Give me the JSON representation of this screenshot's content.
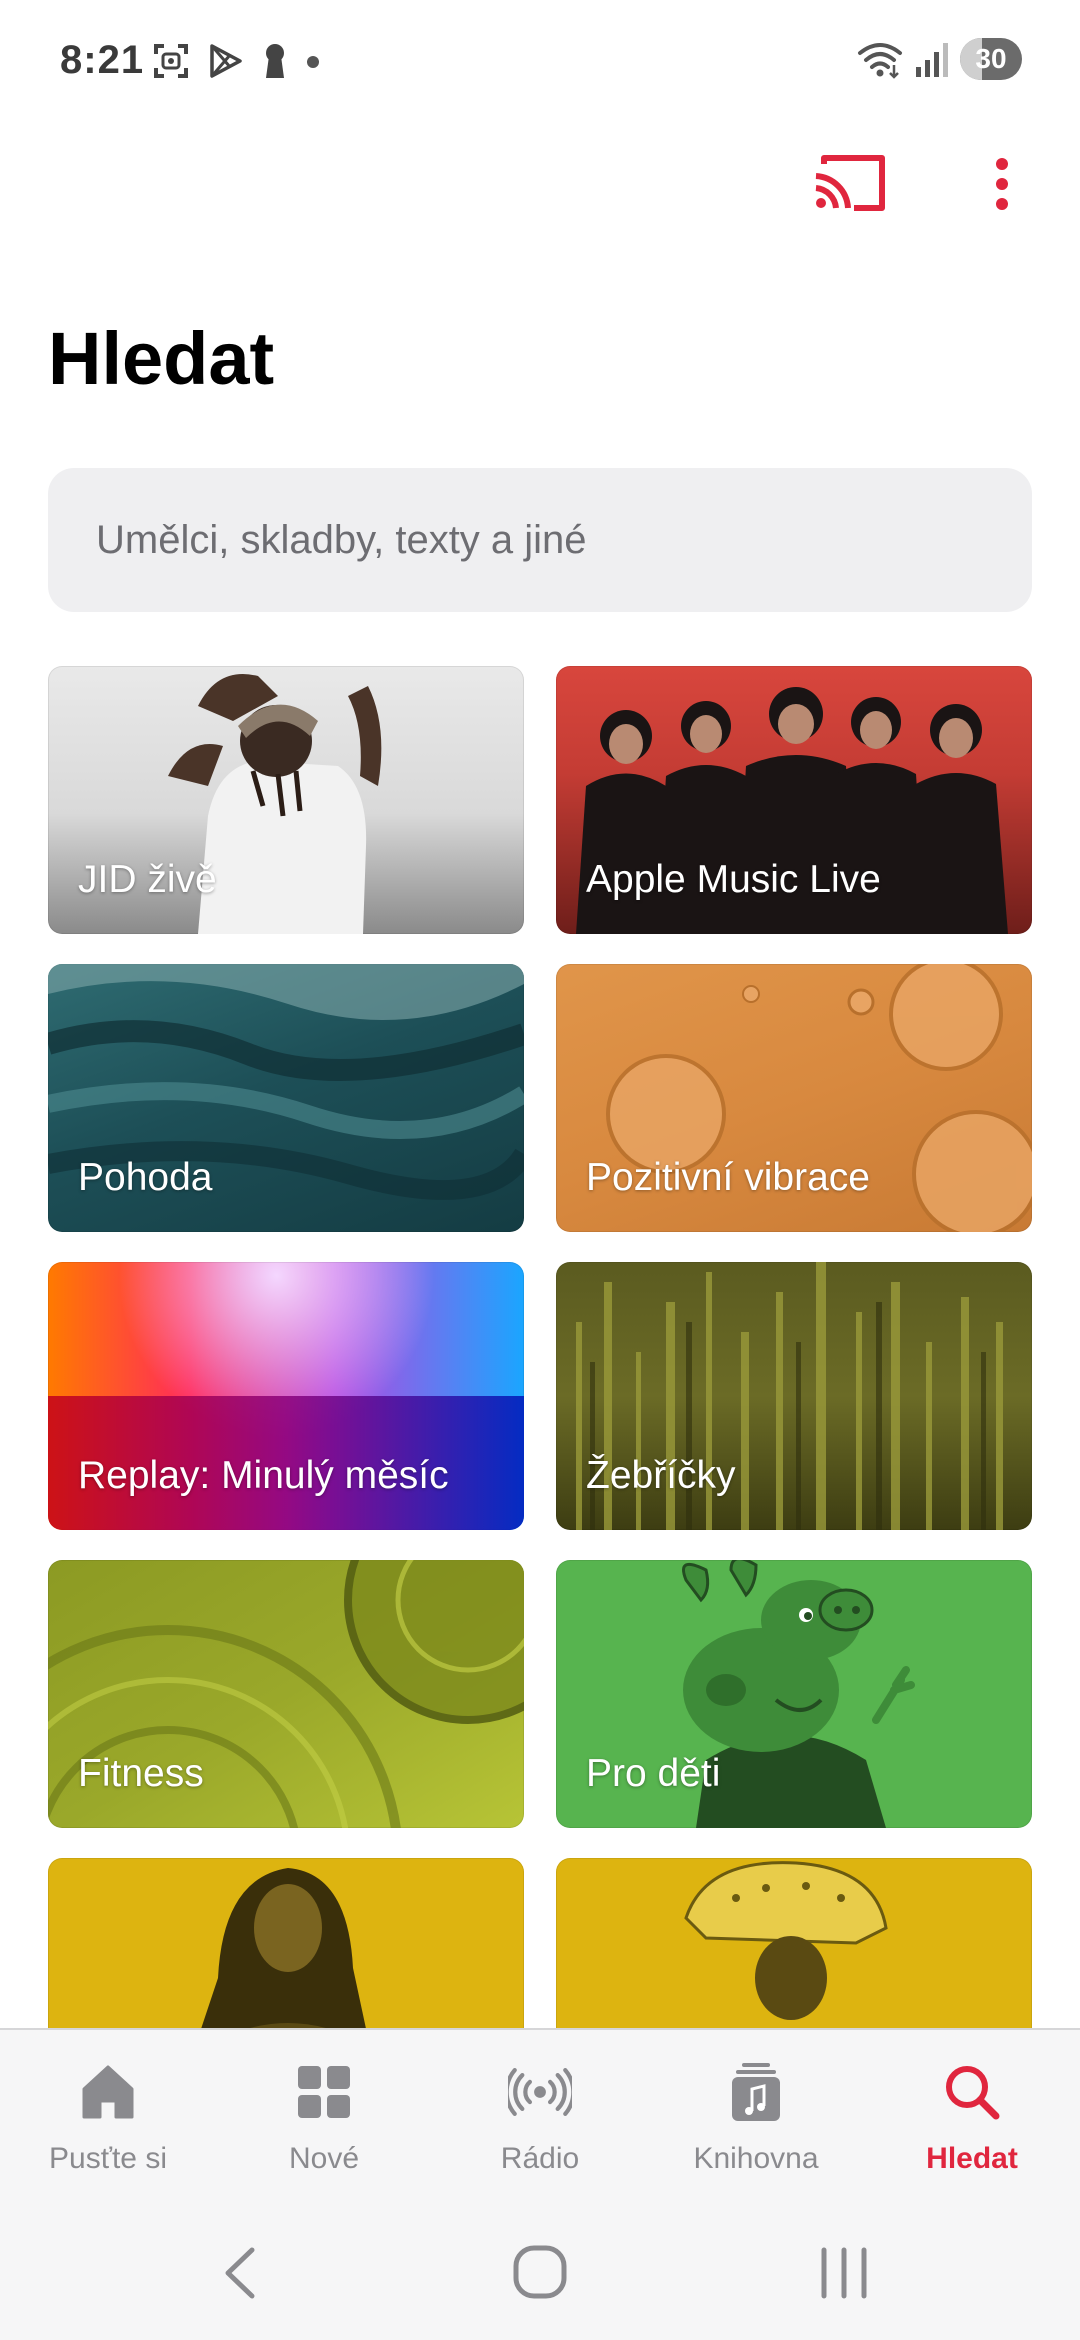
{
  "status_bar": {
    "time": "8:21",
    "battery": "30"
  },
  "header": {
    "cast_icon": "cast-icon",
    "more_icon": "more-vertical-icon"
  },
  "page": {
    "title": "Hledat"
  },
  "search": {
    "placeholder": "Umělci, skladby, texty a jiné"
  },
  "categories": [
    {
      "label": "JID živě"
    },
    {
      "label": "Apple Music Live"
    },
    {
      "label": "Pohoda"
    },
    {
      "label": "Pozitivní vibrace"
    },
    {
      "label": "Replay: Minulý měsíc"
    },
    {
      "label": "Žebříčky"
    },
    {
      "label": "Fitness"
    },
    {
      "label": "Pro děti"
    },
    {
      "label": ""
    },
    {
      "label": ""
    }
  ],
  "tabs": [
    {
      "label": "Pusťte si",
      "icon": "home-icon"
    },
    {
      "label": "Nové",
      "icon": "grid-icon"
    },
    {
      "label": "Rádio",
      "icon": "radio-icon"
    },
    {
      "label": "Knihovna",
      "icon": "library-icon"
    },
    {
      "label": "Hledat",
      "icon": "search-icon",
      "active": true
    }
  ],
  "colors": {
    "accent": "#e0263e",
    "search_bg": "#efeff1",
    "tab_inactive": "#8a8a8e"
  }
}
